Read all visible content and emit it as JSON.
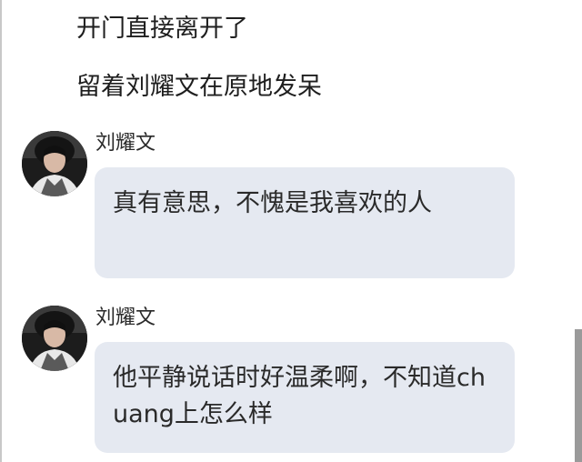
{
  "narration": [
    "开门直接离开了",
    "留着刘耀文在原地发呆"
  ],
  "messages": [
    {
      "sender": "刘耀文",
      "text": "真有意思，不愧是我喜欢的人"
    },
    {
      "sender": "刘耀文",
      "text": "他平静说话时好温柔啊，不知道chuang上怎么样"
    }
  ],
  "colors": {
    "bubble": "#e5e9f1",
    "text": "#2a2a2a",
    "scrollbar": "#9a9a9a"
  },
  "icons": {
    "avatar": "profile-photo"
  }
}
